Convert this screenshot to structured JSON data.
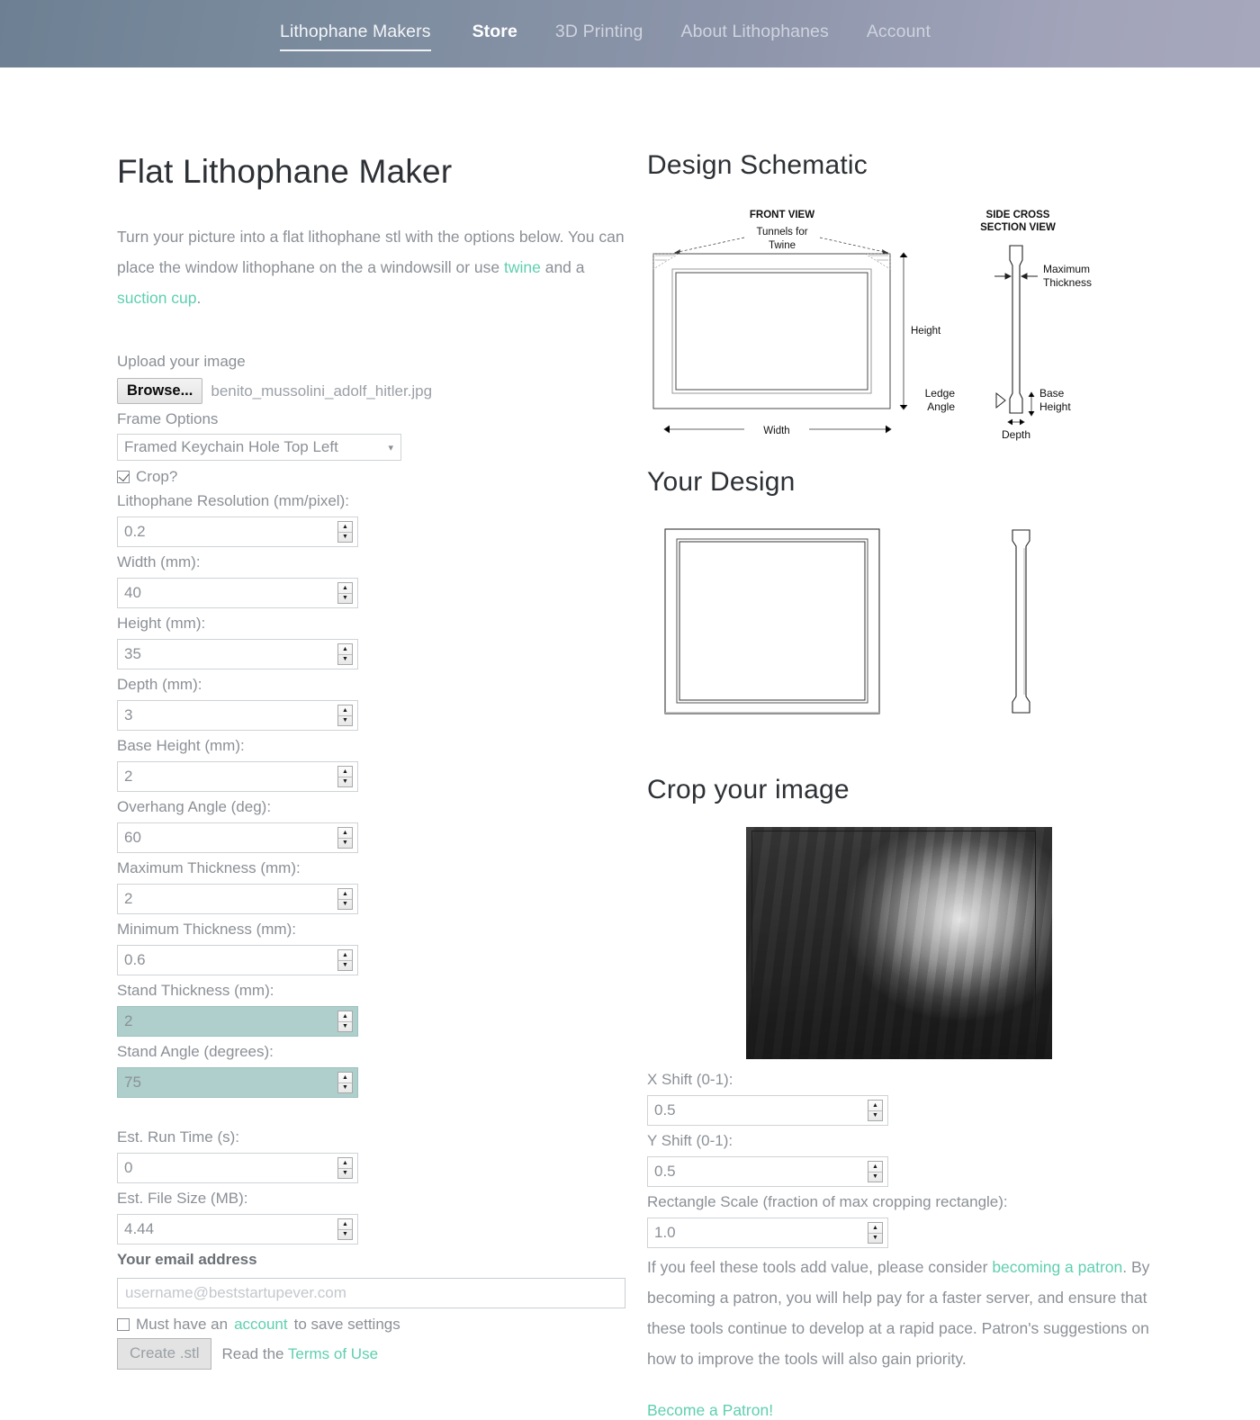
{
  "nav": {
    "items": [
      {
        "label": "Lithophane Makers",
        "state": "active"
      },
      {
        "label": "Store",
        "state": "strong"
      },
      {
        "label": "3D Printing",
        "state": "dim"
      },
      {
        "label": "About Lithophanes",
        "state": "dim"
      },
      {
        "label": "Account",
        "state": "dim"
      }
    ]
  },
  "left": {
    "title": "Flat Lithophane Maker",
    "intro_1": "Turn your picture into a flat lithophane stl with the options below. You can place the window lithophane on the a windowsill or use ",
    "intro_link_1": "twine",
    "intro_2": " and a ",
    "intro_link_2": "suction cup",
    "intro_3": ".",
    "upload_label": "Upload your image",
    "browse_label": "Browse...",
    "file_name": "benito_mussolini_adolf_hitler.jpg",
    "frame_options_label": "Frame Options",
    "frame_option_selected": "Framed Keychain Hole Top Left",
    "crop_label": "Crop?",
    "crop_checked": true,
    "fields": [
      {
        "label": "Lithophane Resolution (mm/pixel):",
        "value": "0.2",
        "disabled": false
      },
      {
        "label": "Width (mm):",
        "value": "40",
        "disabled": false
      },
      {
        "label": "Height (mm):",
        "value": "35",
        "disabled": false
      },
      {
        "label": "Depth (mm):",
        "value": "3",
        "disabled": false
      },
      {
        "label": "Base Height (mm):",
        "value": "2",
        "disabled": false
      },
      {
        "label": "Overhang Angle (deg):",
        "value": "60",
        "disabled": false
      },
      {
        "label": "Maximum Thickness (mm):",
        "value": "2",
        "disabled": false
      },
      {
        "label": "Minimum Thickness (mm):",
        "value": "0.6",
        "disabled": false
      },
      {
        "label": "Stand Thickness (mm):",
        "value": "2",
        "disabled": true
      },
      {
        "label": "Stand Angle (degrees):",
        "value": "75",
        "disabled": true
      }
    ],
    "fields_2": [
      {
        "label": "Est. Run Time (s):",
        "value": "0"
      },
      {
        "label": "Est. File Size (MB):",
        "value": "4.44"
      }
    ],
    "email_heading": "Your email address",
    "email_placeholder": "username@beststartupever.com",
    "must_have_1": "Must have an ",
    "must_have_link": "account",
    "must_have_2": " to save settings",
    "must_have_checked": false,
    "create_label": "Create .stl",
    "read_the": "Read the ",
    "terms_link": "Terms of Use"
  },
  "right": {
    "schematic_heading": "Design Schematic",
    "design_heading": "Your Design",
    "crop_heading": "Crop your image",
    "schematic": {
      "front_view_title": "FRONT VIEW",
      "tunnels_line1": "Tunnels for",
      "tunnels_line2": "Twine",
      "height_label": "Height",
      "width_label": "Width",
      "side_title_line1": "SIDE CROSS",
      "side_title_line2": "SECTION VIEW",
      "max_thickness_line1": "Maximum",
      "max_thickness_line2": "Thickness",
      "ledge_angle_line1": "Ledge",
      "ledge_angle_line2": "Angle",
      "base_height_line1": "Base",
      "base_height_line2": "Height",
      "depth_label": "Depth"
    },
    "crop_fields": [
      {
        "label": "X Shift (0-1):",
        "value": "0.5"
      },
      {
        "label": "Y Shift (0-1):",
        "value": "0.5"
      },
      {
        "label": "Rectangle Scale (fraction of max cropping rectangle):",
        "value": "1.0"
      }
    ],
    "patron_note_1": "If you feel these tools add value, please consider ",
    "patron_note_link": "becoming a patron",
    "patron_note_2": ". By becoming a patron, you will help pay for a faster server, and ensure that these tools continue to develop at a rapid pace. Patron's suggestions on how to improve the tools will also gain priority.",
    "patron_cta": "Become a Patron!"
  },
  "colors": {
    "accent_teal": "#5fcfb0",
    "disabled_field": "#aecfcb",
    "header_left": "#6d8093",
    "header_right": "#a6a7bc",
    "heading_text": "#2d3135",
    "body_text": "#8b9096"
  }
}
